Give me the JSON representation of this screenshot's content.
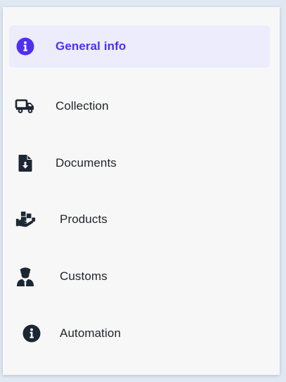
{
  "menu": {
    "items": [
      {
        "label": "General info",
        "icon": "info-circle-icon",
        "active": true
      },
      {
        "label": "Collection",
        "icon": "truck-icon",
        "active": false
      },
      {
        "label": "Documents",
        "icon": "file-download-icon",
        "active": false
      },
      {
        "label": "Products",
        "icon": "hand-holding-boxes-icon",
        "active": false
      },
      {
        "label": "Customs",
        "icon": "officer-icon",
        "active": false
      },
      {
        "label": "Automation",
        "icon": "info-circle-icon",
        "active": false
      }
    ]
  },
  "colors": {
    "accent": "#4f2ff0",
    "active_bg": "#ececfd",
    "icon_dark": "#1b2733",
    "text": "#1f2329",
    "panel_bg": "#f8f7f8",
    "page_bg": "#dfe8f3"
  }
}
